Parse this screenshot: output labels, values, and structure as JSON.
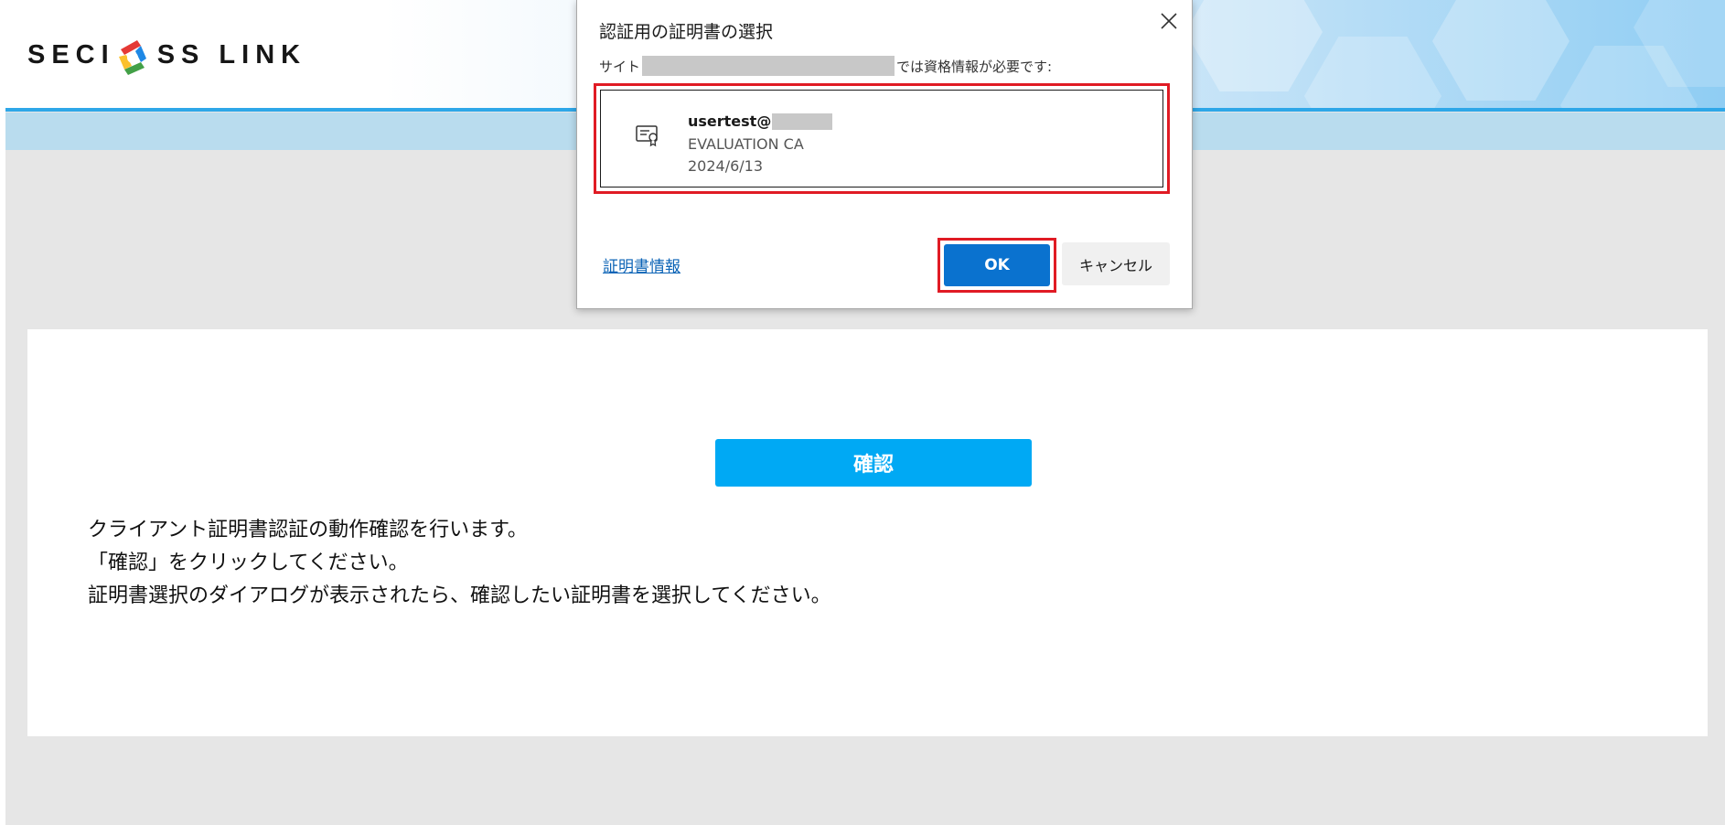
{
  "header": {
    "logo_left": "SECI",
    "logo_right": "SS LINK"
  },
  "main": {
    "confirm_label": "確認",
    "instructions": [
      "クライアント証明書認証の動作確認を行います。",
      "「確認」をクリックしてください。",
      "証明書選択のダイアログが表示されたら、確認したい証明書を選択してください。"
    ]
  },
  "dialog": {
    "title": "認証用の証明書の選択",
    "site_prefix": "サイト",
    "site_suffix": "では資格情報が必要です:",
    "certificate": {
      "name": "usertest@",
      "issuer": "EVALUATION CA",
      "date": "2024/6/13"
    },
    "info_link": "証明書情報",
    "ok_label": "OK",
    "cancel_label": "キャンセル"
  },
  "colors": {
    "header_line": "#2ea7e8",
    "confirm_button": "#00a9f4",
    "ok_button": "#0a72cf",
    "highlight": "#e01b24",
    "link": "#0b63b6"
  },
  "icons": {
    "close": "close-icon",
    "certificate": "certificate-icon",
    "logo": "logo-mark-icon"
  }
}
